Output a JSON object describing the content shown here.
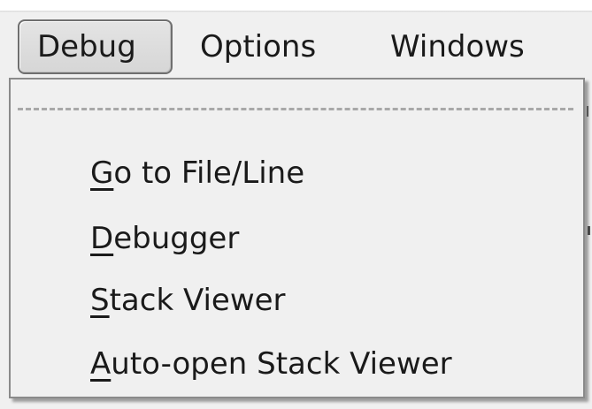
{
  "menubar": {
    "items": [
      {
        "label": "Debug",
        "active": true
      },
      {
        "label": "Options",
        "active": false
      },
      {
        "label": "Windows",
        "active": false
      }
    ]
  },
  "dropdown": {
    "items": [
      {
        "mnemonic": "G",
        "rest": "o to File/Line"
      },
      {
        "mnemonic": "D",
        "rest": "ebugger"
      },
      {
        "mnemonic": "S",
        "rest": "tack Viewer"
      },
      {
        "mnemonic": "A",
        "rest": "uto-open Stack Viewer"
      }
    ]
  }
}
